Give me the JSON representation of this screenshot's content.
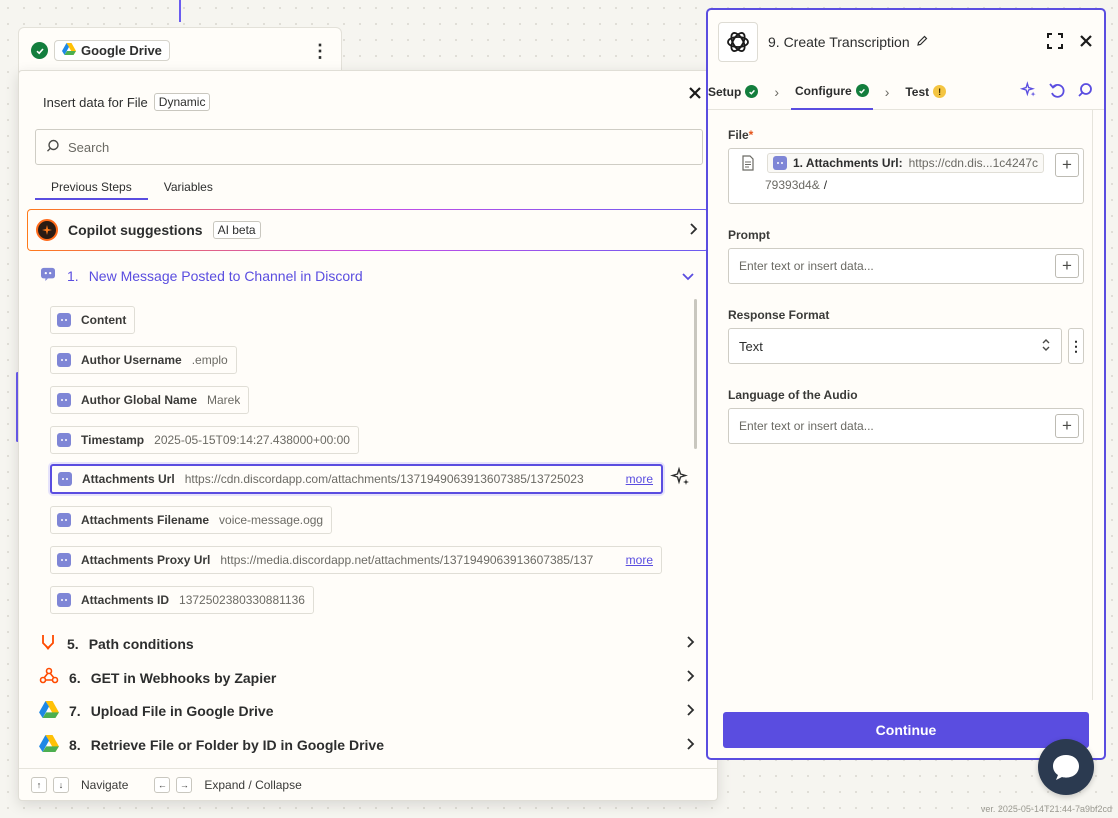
{
  "canvas": {
    "version": "ver. 2025-05-14T21:44-7a9bf2cd"
  },
  "node_card": {
    "app": "Google Drive"
  },
  "popup": {
    "title": "Insert data for File",
    "tag": "Dynamic",
    "search_placeholder": "Search",
    "tabs": [
      "Previous Steps",
      "Variables"
    ],
    "copilot": {
      "label": "Copilot suggestions",
      "badge": "AI beta"
    },
    "step1": {
      "number": "1.",
      "title": "New Message Posted to Channel in Discord"
    },
    "fields": [
      {
        "name": "Content",
        "value": ""
      },
      {
        "name": "Author Username",
        "value": ".emplo"
      },
      {
        "name": "Author Global Name",
        "value": "Marek"
      },
      {
        "name": "Timestamp",
        "value": "2025-05-15T09:14:27.438000+00:00"
      },
      {
        "name": "Attachments Url",
        "value": "https://cdn.discordapp.com/attachments/1371949063913607385/13725023",
        "more": "more"
      },
      {
        "name": "Attachments Filename",
        "value": "voice-message.ogg"
      },
      {
        "name": "Attachments Proxy Url",
        "value": "https://media.discordapp.net/attachments/1371949063913607385/137",
        "more": "more"
      },
      {
        "name": "Attachments ID",
        "value": "1372502380330881136"
      }
    ],
    "other_steps": [
      {
        "number": "5.",
        "title": "Path conditions",
        "icon": "path-icon"
      },
      {
        "number": "6.",
        "title": "GET in Webhooks by Zapier",
        "icon": "webhook-icon"
      },
      {
        "number": "7.",
        "title": "Upload File in Google Drive",
        "icon": "google-drive-icon"
      },
      {
        "number": "8.",
        "title": "Retrieve File or Folder by ID in Google Drive",
        "icon": "google-drive-icon"
      }
    ],
    "footer": {
      "navigate": "Navigate",
      "expand": "Expand / Collapse"
    }
  },
  "editor": {
    "title": "9. Create Transcription",
    "tabs": {
      "setup": "Setup",
      "configure": "Configure",
      "test": "Test"
    },
    "file": {
      "label": "File",
      "required": "*",
      "pill_name": "1. Attachments Url:",
      "pill_value": "https://cdn.dis...1c4247c",
      "line2": "79393d4&",
      "slash": "/"
    },
    "prompt": {
      "label": "Prompt",
      "placeholder": "Enter text or insert data..."
    },
    "response_format": {
      "label": "Response Format",
      "value": "Text"
    },
    "language": {
      "label": "Language of the Audio",
      "placeholder": "Enter text or insert data..."
    },
    "continue": "Continue"
  },
  "colors": {
    "accent": "#5a4de0",
    "success": "#137e3d",
    "warning": "#f4c542"
  }
}
